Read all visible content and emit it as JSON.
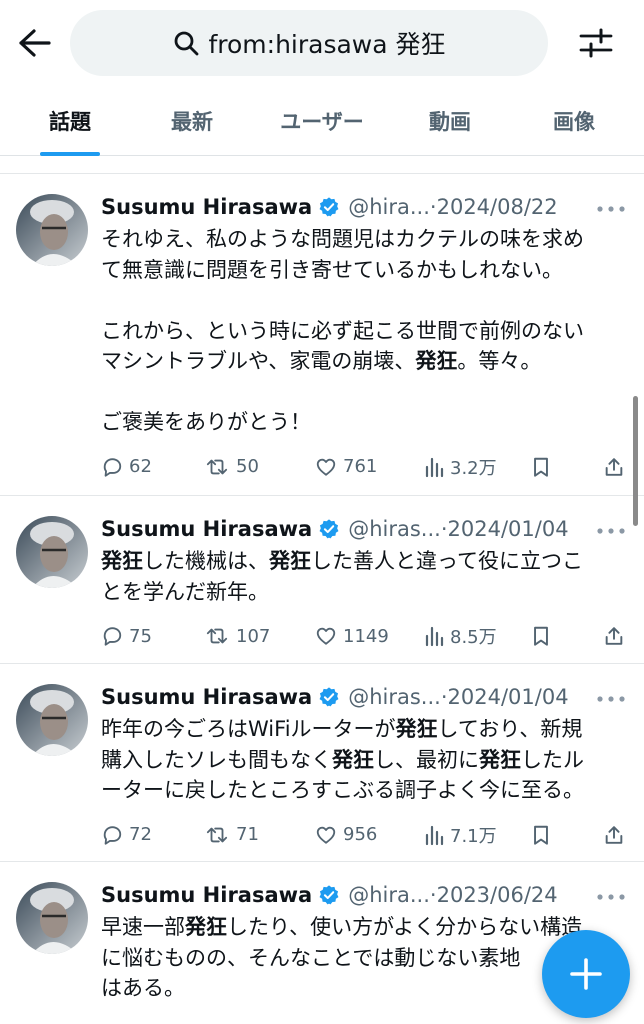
{
  "header": {
    "search_query": "from:hirasawa 発狂"
  },
  "tabs": [
    {
      "label": "話題",
      "active": true
    },
    {
      "label": "最新",
      "active": false
    },
    {
      "label": "ユーザー",
      "active": false
    },
    {
      "label": "動画",
      "active": false
    },
    {
      "label": "画像",
      "active": false
    }
  ],
  "colors": {
    "accent": "#1d9bf0",
    "text": "#0f1419",
    "muted": "#536471"
  },
  "tweets": [
    {
      "name": "Susumu Hirasawa",
      "handle": "@hira...",
      "dot": "·",
      "date": "2024/08/22",
      "lines": [
        [
          "それゆえ、私のような問題児はカクテルの味を求め"
        ],
        [
          "て無意識に問題を引き寄せているかもしれない。"
        ],
        [],
        [
          "これから、という時に必ず起こる世間で前例のない"
        ],
        [
          "マシントラブルや、家電の崩壊、",
          "発狂",
          "。等々。"
        ],
        [],
        [
          "ご褒美をありがとう！"
        ]
      ],
      "replies": "62",
      "retweets": "50",
      "likes": "761",
      "views": "3.2万"
    },
    {
      "name": "Susumu Hirasawa",
      "handle": "@hiras...",
      "dot": "·",
      "date": "2024/01/04",
      "lines": [
        [
          "",
          "発狂",
          "した機械は、",
          "発狂",
          "した善人と違って役に立つこ"
        ],
        [
          "とを学んだ新年。"
        ]
      ],
      "replies": "75",
      "retweets": "107",
      "likes": "1149",
      "views": "8.5万"
    },
    {
      "name": "Susumu Hirasawa",
      "handle": "@hiras...",
      "dot": "·",
      "date": "2024/01/04",
      "lines": [
        [
          "昨年の今ごろはWiFiルーターが",
          "発狂",
          "しており、新規"
        ],
        [
          "購入したソレも間もなく",
          "発狂",
          "し、最初に",
          "発狂",
          "したル"
        ],
        [
          "ーターに戻したところすこぶる調子よく今に至る。"
        ]
      ],
      "replies": "72",
      "retweets": "71",
      "likes": "956",
      "views": "7.1万"
    },
    {
      "name": "Susumu Hirasawa",
      "handle": "@hira...",
      "dot": "·",
      "date": "2023/06/24",
      "lines": [
        [
          "早速一部",
          "発狂",
          "したり、使い方がよく分からない構造"
        ],
        [
          "に悩むものの、そんなことでは動じない素地"
        ],
        [
          "はある。"
        ]
      ]
    }
  ],
  "icons": {
    "back": "arrow-left-icon",
    "search": "search-icon",
    "filter": "filter-sliders-icon",
    "more": "more-dots-icon",
    "verified": "verified-badge-icon",
    "reply": "reply-icon",
    "retweet": "retweet-icon",
    "like": "heart-icon",
    "views": "views-chart-icon",
    "bookmark": "bookmark-icon",
    "share": "share-icon",
    "compose": "compose-plus-icon"
  }
}
